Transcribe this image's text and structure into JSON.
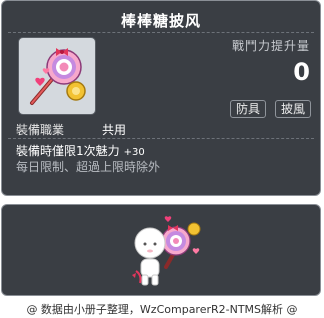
{
  "item": {
    "id": "01102778",
    "name": "棒棒糖披风"
  },
  "stats": {
    "power_label": "戰鬥力提升量",
    "power_value": "0"
  },
  "tags": [
    "防具",
    "披風"
  ],
  "job": {
    "label": "裝備職業",
    "value": "共用"
  },
  "effect": {
    "text": "裝備時僅限1次魅力",
    "amount": "+30"
  },
  "limit_text": "每日限制、超過上限時除外",
  "footer": "@ 数据由小册子整理，WzComparerR2-NTMS解析 @",
  "colors": {
    "tooltip_bg": "#3a3e44",
    "icon_bg": "#d4d9de",
    "lollipop_pink": "#f38ab8",
    "lollipop_purple": "#9a5bd0",
    "lollipop_yellow": "#f2c232"
  },
  "icons": [
    "lollipop-cape-icon",
    "character-preview"
  ]
}
